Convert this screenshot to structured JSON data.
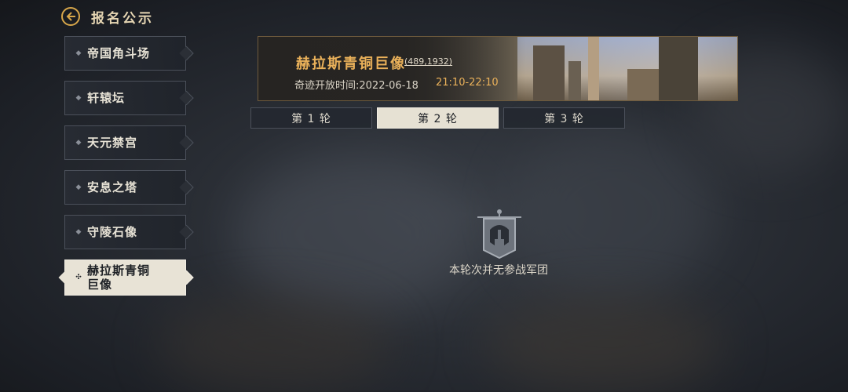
{
  "header": {
    "title": "报名公示"
  },
  "sidebar": {
    "items": [
      {
        "label": "帝国角斗场"
      },
      {
        "label": "轩辕坛"
      },
      {
        "label": "天元禁宫"
      },
      {
        "label": "安息之塔"
      },
      {
        "label": "守陵石像"
      },
      {
        "label": "赫拉斯青铜巨像"
      }
    ]
  },
  "banner": {
    "name": "赫拉斯青铜巨像",
    "coords": "(489,1932)",
    "time_label": "奇迹开放时间:2022-06-18",
    "time_range": "21:10-22:10"
  },
  "tabs": [
    {
      "label": "第 1 轮"
    },
    {
      "label": "第 2 轮"
    },
    {
      "label": "第 3 轮"
    }
  ],
  "empty_state": {
    "icon": "banner-helmet-icon",
    "text": "本轮次并无参战军团"
  },
  "colors": {
    "accent": "#eab15a",
    "active_bg": "#e6e1d3"
  }
}
